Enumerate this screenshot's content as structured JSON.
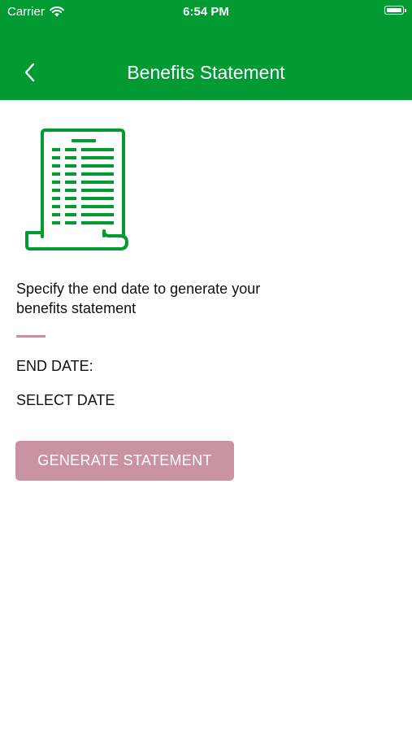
{
  "status_bar": {
    "carrier": "Carrier",
    "time": "6:54 PM"
  },
  "nav": {
    "title": "Benefits Statement",
    "back_icon": "chevron-left-icon"
  },
  "illustration": {
    "icon": "document-statement-icon",
    "color": "#029a33"
  },
  "form": {
    "description": "Specify the end date to generate your benefits statement",
    "end_date_label": "END DATE:",
    "select_date": "SELECT DATE",
    "generate_button": "GENERATE STATEMENT"
  },
  "colors": {
    "header_bg": "#029a33",
    "accent": "#c993a3",
    "divider": "#c98fa1"
  }
}
